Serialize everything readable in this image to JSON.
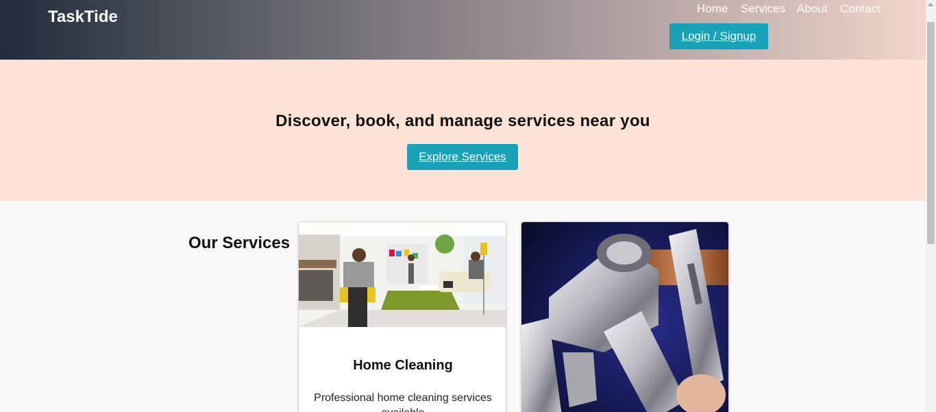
{
  "header": {
    "brand": "TaskTide",
    "nav": [
      "Home",
      "Services",
      "About",
      "Contact"
    ],
    "login_label": "Login / Signup"
  },
  "hero": {
    "title": "Discover, book, and manage services near you",
    "cta_label": "Explore Services"
  },
  "services": {
    "title": "Our Services",
    "cards": [
      {
        "title": "Home Cleaning",
        "description": "Professional home cleaning services available"
      },
      {
        "title": "",
        "description": ""
      }
    ]
  },
  "colors": {
    "accent": "#17a2b8",
    "hero_bg": "#fde3d5",
    "header_start": "#212b3a",
    "header_end": "#f1d6cb"
  }
}
